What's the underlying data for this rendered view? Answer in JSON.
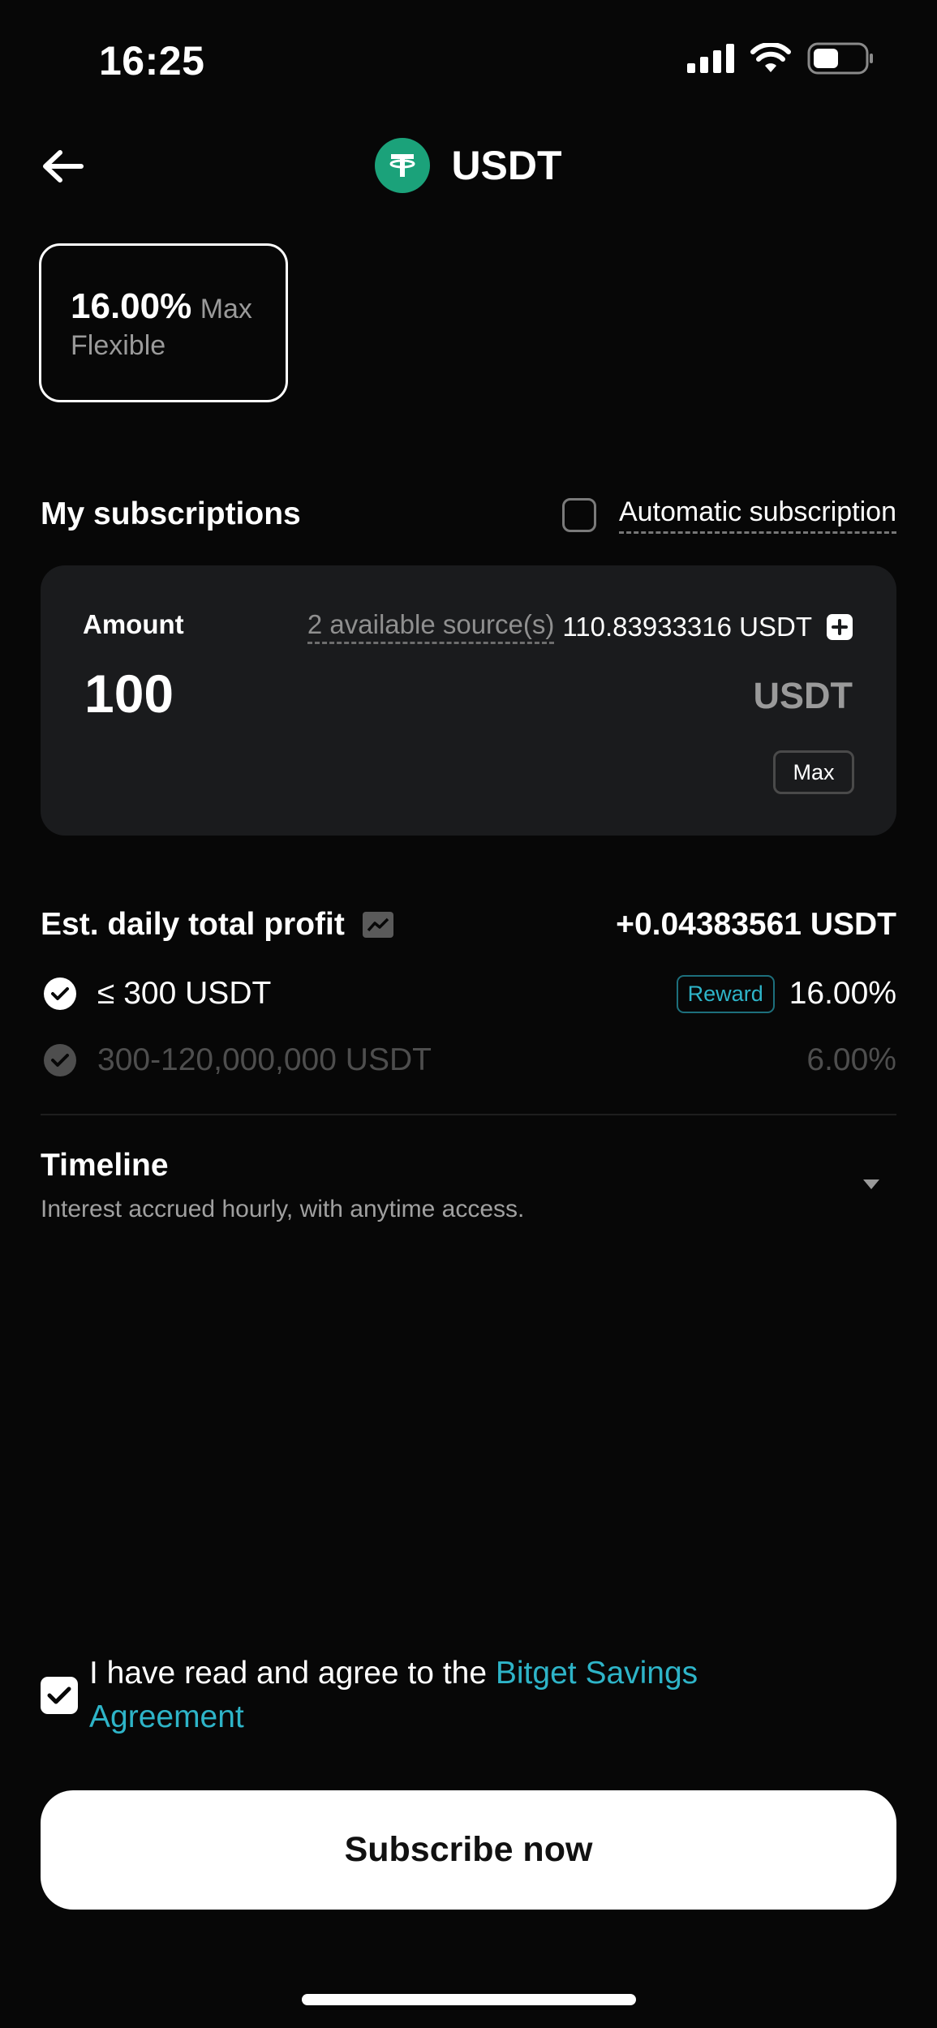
{
  "status_bar": {
    "time": "16:25"
  },
  "header": {
    "title": "USDT",
    "coin_icon": "tether-icon",
    "back_icon": "arrow-left-icon"
  },
  "product": {
    "rate": "16.00%",
    "rate_suffix": "Max",
    "type": "Flexible"
  },
  "subscriptions": {
    "title": "My subscriptions",
    "auto_label": "Automatic subscription",
    "auto_checked": false
  },
  "amount": {
    "label": "Amount",
    "sources_link": "2 available source(s)",
    "available": "110.83933316 USDT",
    "value": "100",
    "unit": "USDT",
    "max_label": "Max"
  },
  "profit": {
    "title": "Est. daily total profit",
    "value": "+0.04383561 USDT",
    "tiers": [
      {
        "label": "≤ 300 USDT",
        "badge": "Reward",
        "rate": "16.00%",
        "active": true
      },
      {
        "label": "300-120,000,000 USDT",
        "badge": "",
        "rate": "6.00%",
        "active": false
      }
    ]
  },
  "timeline": {
    "title": "Timeline",
    "subtitle": "Interest accrued hourly, with anytime access."
  },
  "agreement": {
    "checked": true,
    "text": "I have read and agree to the ",
    "link": "Bitget Savings Agreement"
  },
  "actions": {
    "subscribe_label": "Subscribe now"
  },
  "colors": {
    "accent": "#2eb4c8",
    "tether": "#1ba27a",
    "background": "#070707",
    "card": "#1a1b1d"
  }
}
